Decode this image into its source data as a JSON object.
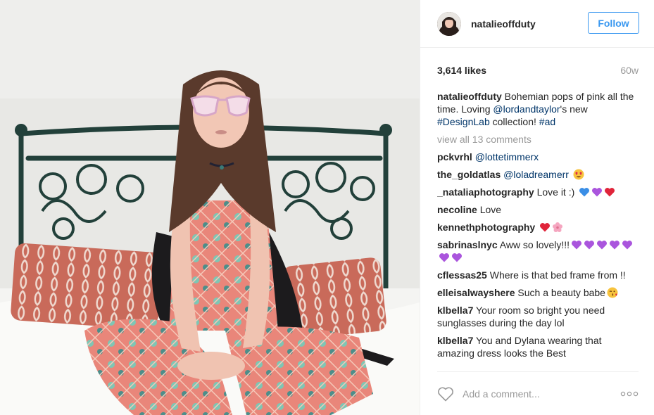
{
  "post": {
    "username": "natalieoffduty",
    "follow_label": "Follow",
    "likes": "3,614 likes",
    "age": "60w"
  },
  "caption": {
    "username": "natalieoffduty",
    "text_1": "Bohemian pops of pink all the time. Loving",
    "mention": "@lordandtaylor",
    "text_2": "'s new",
    "hashtag_1": "#DesignLab",
    "text_3": "collection!",
    "hashtag_2": "#ad"
  },
  "view_all": "view all 13 comments",
  "comments": [
    {
      "user": "pckvrhl",
      "mention": "@lottetimmerx",
      "text": ""
    },
    {
      "user": "the_goldatlas",
      "mention": "@loladreamerr",
      "text": ""
    },
    {
      "user": "_nataliaphotography",
      "mention": "",
      "text": "Love it :)"
    },
    {
      "user": "necoline",
      "mention": "",
      "text": "Love"
    },
    {
      "user": "kennethphotography",
      "mention": "",
      "text": ""
    },
    {
      "user": "sabrinaslnyc",
      "mention": "",
      "text": "Aww so lovely!!!"
    },
    {
      "user": "cflessas25",
      "mention": "",
      "text": "Where is that bed frame from !!"
    },
    {
      "user": "elleisalwayshere",
      "mention": "",
      "text": "Such a beauty babe"
    },
    {
      "user": "klbella7",
      "mention": "",
      "text": "Your room so bright you need sunglasses during the day lol"
    },
    {
      "user": "klbella7",
      "mention": "",
      "text": "You and Dylana wearing that amazing dress looks the Best"
    }
  ],
  "add_comment": {
    "placeholder": "Add a comment..."
  },
  "icons": {
    "like": "heart-outline-icon",
    "more": "more-options-icon"
  },
  "colors": {
    "follow_blue": "#3897f0",
    "link_blue": "#003569",
    "muted": "#999999",
    "heart_red": "#ed4956",
    "purple_heart": "#aa55dd",
    "blue_heart": "#3a8ee6"
  }
}
